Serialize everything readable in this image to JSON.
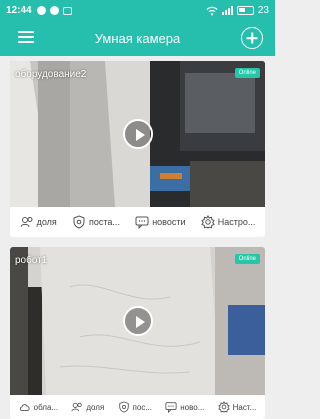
{
  "status_bar": {
    "time": "12:44",
    "battery": "23"
  },
  "header": {
    "title": "Умная камера"
  },
  "cameras": [
    {
      "name": "оборудование2",
      "status": "Online",
      "actions": [
        "доля",
        "поста...",
        "новости",
        "Настро..."
      ]
    },
    {
      "name": "робот1",
      "status": "Online",
      "actions": [
        "обла...",
        "доля",
        "пос...",
        "ново...",
        "Наст..."
      ]
    }
  ],
  "colors": {
    "accent": "#26bfae",
    "badge": "#25c7a7",
    "background": "#efeeee"
  }
}
